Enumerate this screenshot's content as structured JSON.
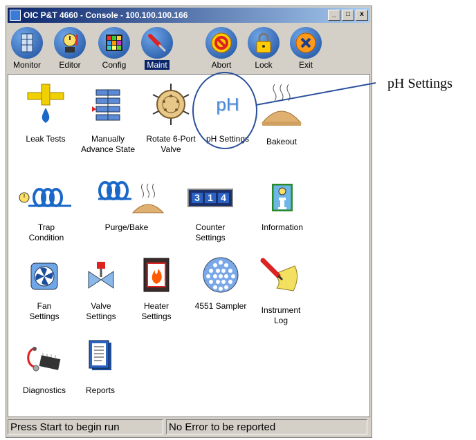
{
  "window": {
    "title": "OIC P&T 4660 - Console - 100.100.100.166",
    "controls": [
      "_",
      "□",
      "x"
    ]
  },
  "toolbar": {
    "buttons": [
      {
        "label": "Monitor",
        "icon": "monitor-icon"
      },
      {
        "label": "Editor",
        "icon": "editor-timer-icon"
      },
      {
        "label": "Config",
        "icon": "config-grid-icon"
      },
      {
        "label": "Maint",
        "icon": "maint-screwdriver-icon",
        "active": true
      },
      {
        "label": "Abort",
        "icon": "abort-icon"
      },
      {
        "label": "Lock",
        "icon": "lock-icon"
      },
      {
        "label": "Exit",
        "icon": "exit-icon"
      }
    ]
  },
  "maint_items": [
    {
      "label": "Leak Tests",
      "icon": "leak-test-icon"
    },
    {
      "label": "Manually\nAdvance State",
      "icon": "advance-state-icon"
    },
    {
      "label": "Rotate 6-Port\nValve",
      "icon": "rotate-valve-icon"
    },
    {
      "label": "pH Settings",
      "icon": "ph-icon",
      "icon_text": "pH"
    },
    {
      "label": "Bakeout",
      "icon": "bakeout-icon"
    },
    {
      "label": "Trap\nCondition",
      "icon": "trap-condition-icon"
    },
    {
      "label": "Purge/Bake",
      "icon": "purge-bake-icon"
    },
    {
      "label": "Counter\nSettings",
      "icon": "counter-icon",
      "icon_text": [
        "3",
        "1",
        "4"
      ]
    },
    {
      "label": "Information",
      "icon": "information-icon"
    },
    {
      "label": "Fan\nSettings",
      "icon": "fan-icon"
    },
    {
      "label": "Valve\nSettings",
      "icon": "valve-icon"
    },
    {
      "label": "Heater\nSettings",
      "icon": "heater-icon"
    },
    {
      "label": "4551 Sampler",
      "icon": "sampler-icon"
    },
    {
      "label": "Instrument\nLog",
      "icon": "instrument-log-icon"
    },
    {
      "label": "Diagnostics",
      "icon": "diagnostics-icon"
    },
    {
      "label": "Reports",
      "icon": "reports-icon"
    }
  ],
  "status": {
    "left": "Press Start to begin run",
    "right": "No Error to be reported"
  },
  "callout": {
    "text": "pH Settings",
    "color": "#2a4f9c"
  }
}
